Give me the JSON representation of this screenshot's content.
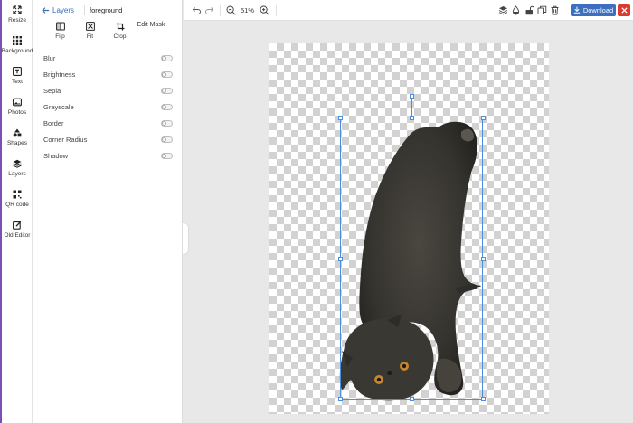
{
  "rail": [
    {
      "label": "Resize",
      "icon": "resize-icon"
    },
    {
      "label": "Background",
      "icon": "background-icon"
    },
    {
      "label": "Text",
      "icon": "text-icon"
    },
    {
      "label": "Photos",
      "icon": "photos-icon"
    },
    {
      "label": "Shapes",
      "icon": "shapes-icon"
    },
    {
      "label": "Layers",
      "icon": "layers-icon"
    },
    {
      "label": "QR code",
      "icon": "qr-code-icon"
    },
    {
      "label": "Old Editor",
      "icon": "old-editor-icon"
    }
  ],
  "panel": {
    "back_label": "Layers",
    "layer_name": "foreground",
    "tools": {
      "flip": "Flip",
      "fit": "Fit",
      "crop": "Crop",
      "edit_mask": "Edit Mask"
    },
    "effects": [
      {
        "label": "Blur",
        "enabled": false
      },
      {
        "label": "Brightness",
        "enabled": false
      },
      {
        "label": "Sepia",
        "enabled": false
      },
      {
        "label": "Grayscale",
        "enabled": false
      },
      {
        "label": "Border",
        "enabled": false
      },
      {
        "label": "Corner Radius",
        "enabled": false
      },
      {
        "label": "Shadow",
        "enabled": false
      }
    ]
  },
  "toolbar": {
    "zoom": "51%",
    "download_label": "Download"
  },
  "colors": {
    "accent": "#3c6fbf",
    "close": "#d93b30",
    "selection": "#4a8fe0",
    "rail_edge": "#7b4fb5"
  }
}
